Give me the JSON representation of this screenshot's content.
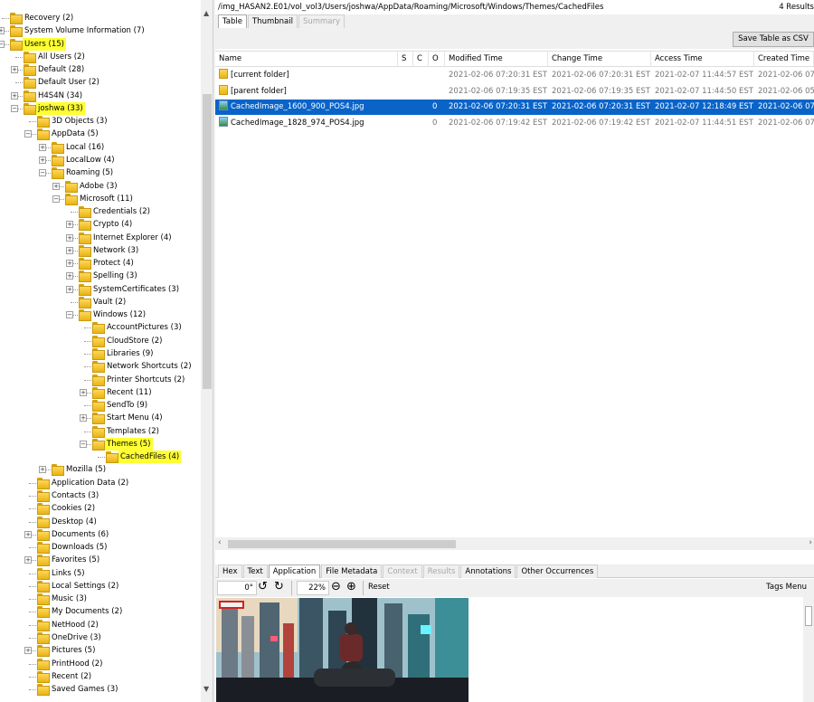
{
  "tree": {
    "items": [
      {
        "label": "Recovery (2)",
        "level": 1,
        "highlight": false,
        "expander": "none"
      },
      {
        "label": "System Volume Information (7)",
        "level": 1,
        "highlight": false,
        "expander": "plus"
      },
      {
        "label": "Users (15)",
        "level": 1,
        "highlight": true,
        "expander": "minus"
      },
      {
        "label": "All Users (2)",
        "level": 2,
        "highlight": false,
        "expander": "none"
      },
      {
        "label": "Default (28)",
        "level": 2,
        "highlight": false,
        "expander": "plus"
      },
      {
        "label": "Default User (2)",
        "level": 2,
        "highlight": false,
        "expander": "none"
      },
      {
        "label": "H4S4N (34)",
        "level": 2,
        "highlight": false,
        "expander": "plus"
      },
      {
        "label": "joshwa (33)",
        "level": 2,
        "highlight": true,
        "expander": "minus"
      },
      {
        "label": "3D Objects (3)",
        "level": 3,
        "highlight": false,
        "expander": "none"
      },
      {
        "label": "AppData (5)",
        "level": 3,
        "highlight": false,
        "expander": "minus"
      },
      {
        "label": "Local (16)",
        "level": 4,
        "highlight": false,
        "expander": "plus"
      },
      {
        "label": "LocalLow (4)",
        "level": 4,
        "highlight": false,
        "expander": "plus"
      },
      {
        "label": "Roaming (5)",
        "level": 4,
        "highlight": false,
        "expander": "minus"
      },
      {
        "label": "Adobe (3)",
        "level": 5,
        "highlight": false,
        "expander": "plus"
      },
      {
        "label": "Microsoft (11)",
        "level": 5,
        "highlight": false,
        "expander": "minus"
      },
      {
        "label": "Credentials (2)",
        "level": 6,
        "highlight": false,
        "expander": "none"
      },
      {
        "label": "Crypto (4)",
        "level": 6,
        "highlight": false,
        "expander": "plus"
      },
      {
        "label": "Internet Explorer (4)",
        "level": 6,
        "highlight": false,
        "expander": "plus"
      },
      {
        "label": "Network (3)",
        "level": 6,
        "highlight": false,
        "expander": "plus"
      },
      {
        "label": "Protect (4)",
        "level": 6,
        "highlight": false,
        "expander": "plus"
      },
      {
        "label": "Spelling (3)",
        "level": 6,
        "highlight": false,
        "expander": "plus"
      },
      {
        "label": "SystemCertificates (3)",
        "level": 6,
        "highlight": false,
        "expander": "plus"
      },
      {
        "label": "Vault (2)",
        "level": 6,
        "highlight": false,
        "expander": "none"
      },
      {
        "label": "Windows (12)",
        "level": 6,
        "highlight": false,
        "expander": "minus"
      },
      {
        "label": "AccountPictures (3)",
        "level": 7,
        "highlight": false,
        "expander": "none"
      },
      {
        "label": "CloudStore (2)",
        "level": 7,
        "highlight": false,
        "expander": "none"
      },
      {
        "label": "Libraries (9)",
        "level": 7,
        "highlight": false,
        "expander": "none"
      },
      {
        "label": "Network Shortcuts (2)",
        "level": 7,
        "highlight": false,
        "expander": "none"
      },
      {
        "label": "Printer Shortcuts (2)",
        "level": 7,
        "highlight": false,
        "expander": "none"
      },
      {
        "label": "Recent (11)",
        "level": 7,
        "highlight": false,
        "expander": "plus"
      },
      {
        "label": "SendTo (9)",
        "level": 7,
        "highlight": false,
        "expander": "none"
      },
      {
        "label": "Start Menu (4)",
        "level": 7,
        "highlight": false,
        "expander": "plus"
      },
      {
        "label": "Templates (2)",
        "level": 7,
        "highlight": false,
        "expander": "none"
      },
      {
        "label": "Themes (5)",
        "level": 7,
        "highlight": true,
        "expander": "minus"
      },
      {
        "label": "CachedFiles (4)",
        "level": 8,
        "highlight": true,
        "expander": "none"
      },
      {
        "label": "Mozilla (5)",
        "level": 4,
        "highlight": false,
        "expander": "plus"
      },
      {
        "label": "Application Data (2)",
        "level": 3,
        "highlight": false,
        "expander": "none"
      },
      {
        "label": "Contacts (3)",
        "level": 3,
        "highlight": false,
        "expander": "none"
      },
      {
        "label": "Cookies (2)",
        "level": 3,
        "highlight": false,
        "expander": "none"
      },
      {
        "label": "Desktop (4)",
        "level": 3,
        "highlight": false,
        "expander": "none"
      },
      {
        "label": "Documents (6)",
        "level": 3,
        "highlight": false,
        "expander": "plus"
      },
      {
        "label": "Downloads (5)",
        "level": 3,
        "highlight": false,
        "expander": "none"
      },
      {
        "label": "Favorites (5)",
        "level": 3,
        "highlight": false,
        "expander": "plus"
      },
      {
        "label": "Links (5)",
        "level": 3,
        "highlight": false,
        "expander": "none"
      },
      {
        "label": "Local Settings (2)",
        "level": 3,
        "highlight": false,
        "expander": "none"
      },
      {
        "label": "Music (3)",
        "level": 3,
        "highlight": false,
        "expander": "none"
      },
      {
        "label": "My Documents (2)",
        "level": 3,
        "highlight": false,
        "expander": "none"
      },
      {
        "label": "NetHood (2)",
        "level": 3,
        "highlight": false,
        "expander": "none"
      },
      {
        "label": "OneDrive (3)",
        "level": 3,
        "highlight": false,
        "expander": "none"
      },
      {
        "label": "Pictures (5)",
        "level": 3,
        "highlight": false,
        "expander": "plus"
      },
      {
        "label": "PrintHood (2)",
        "level": 3,
        "highlight": false,
        "expander": "none"
      },
      {
        "label": "Recent (2)",
        "level": 3,
        "highlight": false,
        "expander": "none"
      },
      {
        "label": "Saved Games (3)",
        "level": 3,
        "highlight": false,
        "expander": "none"
      }
    ]
  },
  "path_bar": {
    "path": "/img_HASAN2.E01/vol_vol3/Users/joshwa/AppData/Roaming/Microsoft/Windows/Themes/CachedFiles",
    "results": "4 Results"
  },
  "result_tabs": [
    {
      "label": "Table",
      "active": true,
      "disabled": false
    },
    {
      "label": "Thumbnail",
      "active": false,
      "disabled": false
    },
    {
      "label": "Summary",
      "active": false,
      "disabled": true
    }
  ],
  "save_csv_label": "Save Table as CSV",
  "table": {
    "headers": {
      "name": "Name",
      "s": "S",
      "c": "C",
      "o": "O",
      "modified": "Modified Time",
      "changed": "Change Time",
      "accessed": "Access Time",
      "created": "Created Time"
    },
    "rows": [
      {
        "icon": "folder",
        "name": "[current folder]",
        "s": "",
        "c": "",
        "o": "",
        "modified": "2021-02-06 07:20:31 EST",
        "changed": "2021-02-06 07:20:31 EST",
        "accessed": "2021-02-07 11:44:57 EST",
        "created": "2021-02-06 07:1",
        "selected": false
      },
      {
        "icon": "folder",
        "name": "[parent folder]",
        "s": "",
        "c": "",
        "o": "",
        "modified": "2021-02-06 07:19:35 EST",
        "changed": "2021-02-06 07:19:35 EST",
        "accessed": "2021-02-07 11:44:50 EST",
        "created": "2021-02-06 05:4",
        "selected": false
      },
      {
        "icon": "image",
        "name": "CachedImage_1600_900_POS4.jpg",
        "s": "",
        "c": "",
        "o": "0",
        "modified": "2021-02-06 07:20:31 EST",
        "changed": "2021-02-06 07:20:31 EST",
        "accessed": "2021-02-07 12:18:49 EST",
        "created": "2021-02-06 07:2",
        "selected": true
      },
      {
        "icon": "image",
        "name": "CachedImage_1828_974_POS4.jpg",
        "s": "",
        "c": "",
        "o": "0",
        "modified": "2021-02-06 07:19:42 EST",
        "changed": "2021-02-06 07:19:42 EST",
        "accessed": "2021-02-07 11:44:51 EST",
        "created": "2021-02-06 07:1",
        "selected": false
      }
    ]
  },
  "content_tabs": [
    {
      "label": "Hex",
      "active": false,
      "disabled": false
    },
    {
      "label": "Text",
      "active": false,
      "disabled": false
    },
    {
      "label": "Application",
      "active": true,
      "disabled": false
    },
    {
      "label": "File Metadata",
      "active": false,
      "disabled": false
    },
    {
      "label": "Context",
      "active": false,
      "disabled": true
    },
    {
      "label": "Results",
      "active": false,
      "disabled": true
    },
    {
      "label": "Annotations",
      "active": false,
      "disabled": false
    },
    {
      "label": "Other Occurrences",
      "active": false,
      "disabled": false
    }
  ],
  "viewer_toolbar": {
    "rotation": "0°",
    "zoom": "22%",
    "reset_label": "Reset",
    "tags_menu_label": "Tags Menu"
  },
  "icons": {
    "rotate_left": "rotate-left-icon",
    "rotate_right": "rotate-right-icon",
    "zoom_out": "zoom-out-icon",
    "zoom_in": "zoom-in-icon"
  },
  "colors": {
    "highlight": "#ffff33",
    "selection": "#0a64c8"
  }
}
